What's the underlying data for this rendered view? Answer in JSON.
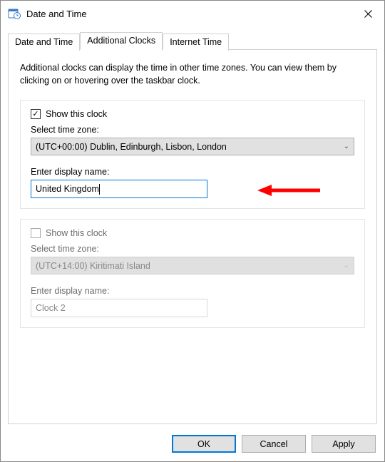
{
  "titlebar": {
    "title": "Date and Time"
  },
  "tabs": {
    "t0": "Date and Time",
    "t1": "Additional Clocks",
    "t2": "Internet Time"
  },
  "description": "Additional clocks can display the time in other time zones. You can view them by clicking on or hovering over the taskbar clock.",
  "clock1": {
    "show_label": "Show this clock",
    "checked": true,
    "tz_label": "Select time zone:",
    "tz_value": "(UTC+00:00) Dublin, Edinburgh, Lisbon, London",
    "name_label": "Enter display name:",
    "name_value": "United Kingdom"
  },
  "clock2": {
    "show_label": "Show this clock",
    "checked": false,
    "tz_label": "Select time zone:",
    "tz_value": "(UTC+14:00) Kiritimati Island",
    "name_label": "Enter display name:",
    "name_value": "Clock 2"
  },
  "buttons": {
    "ok": "OK",
    "cancel": "Cancel",
    "apply": "Apply"
  }
}
